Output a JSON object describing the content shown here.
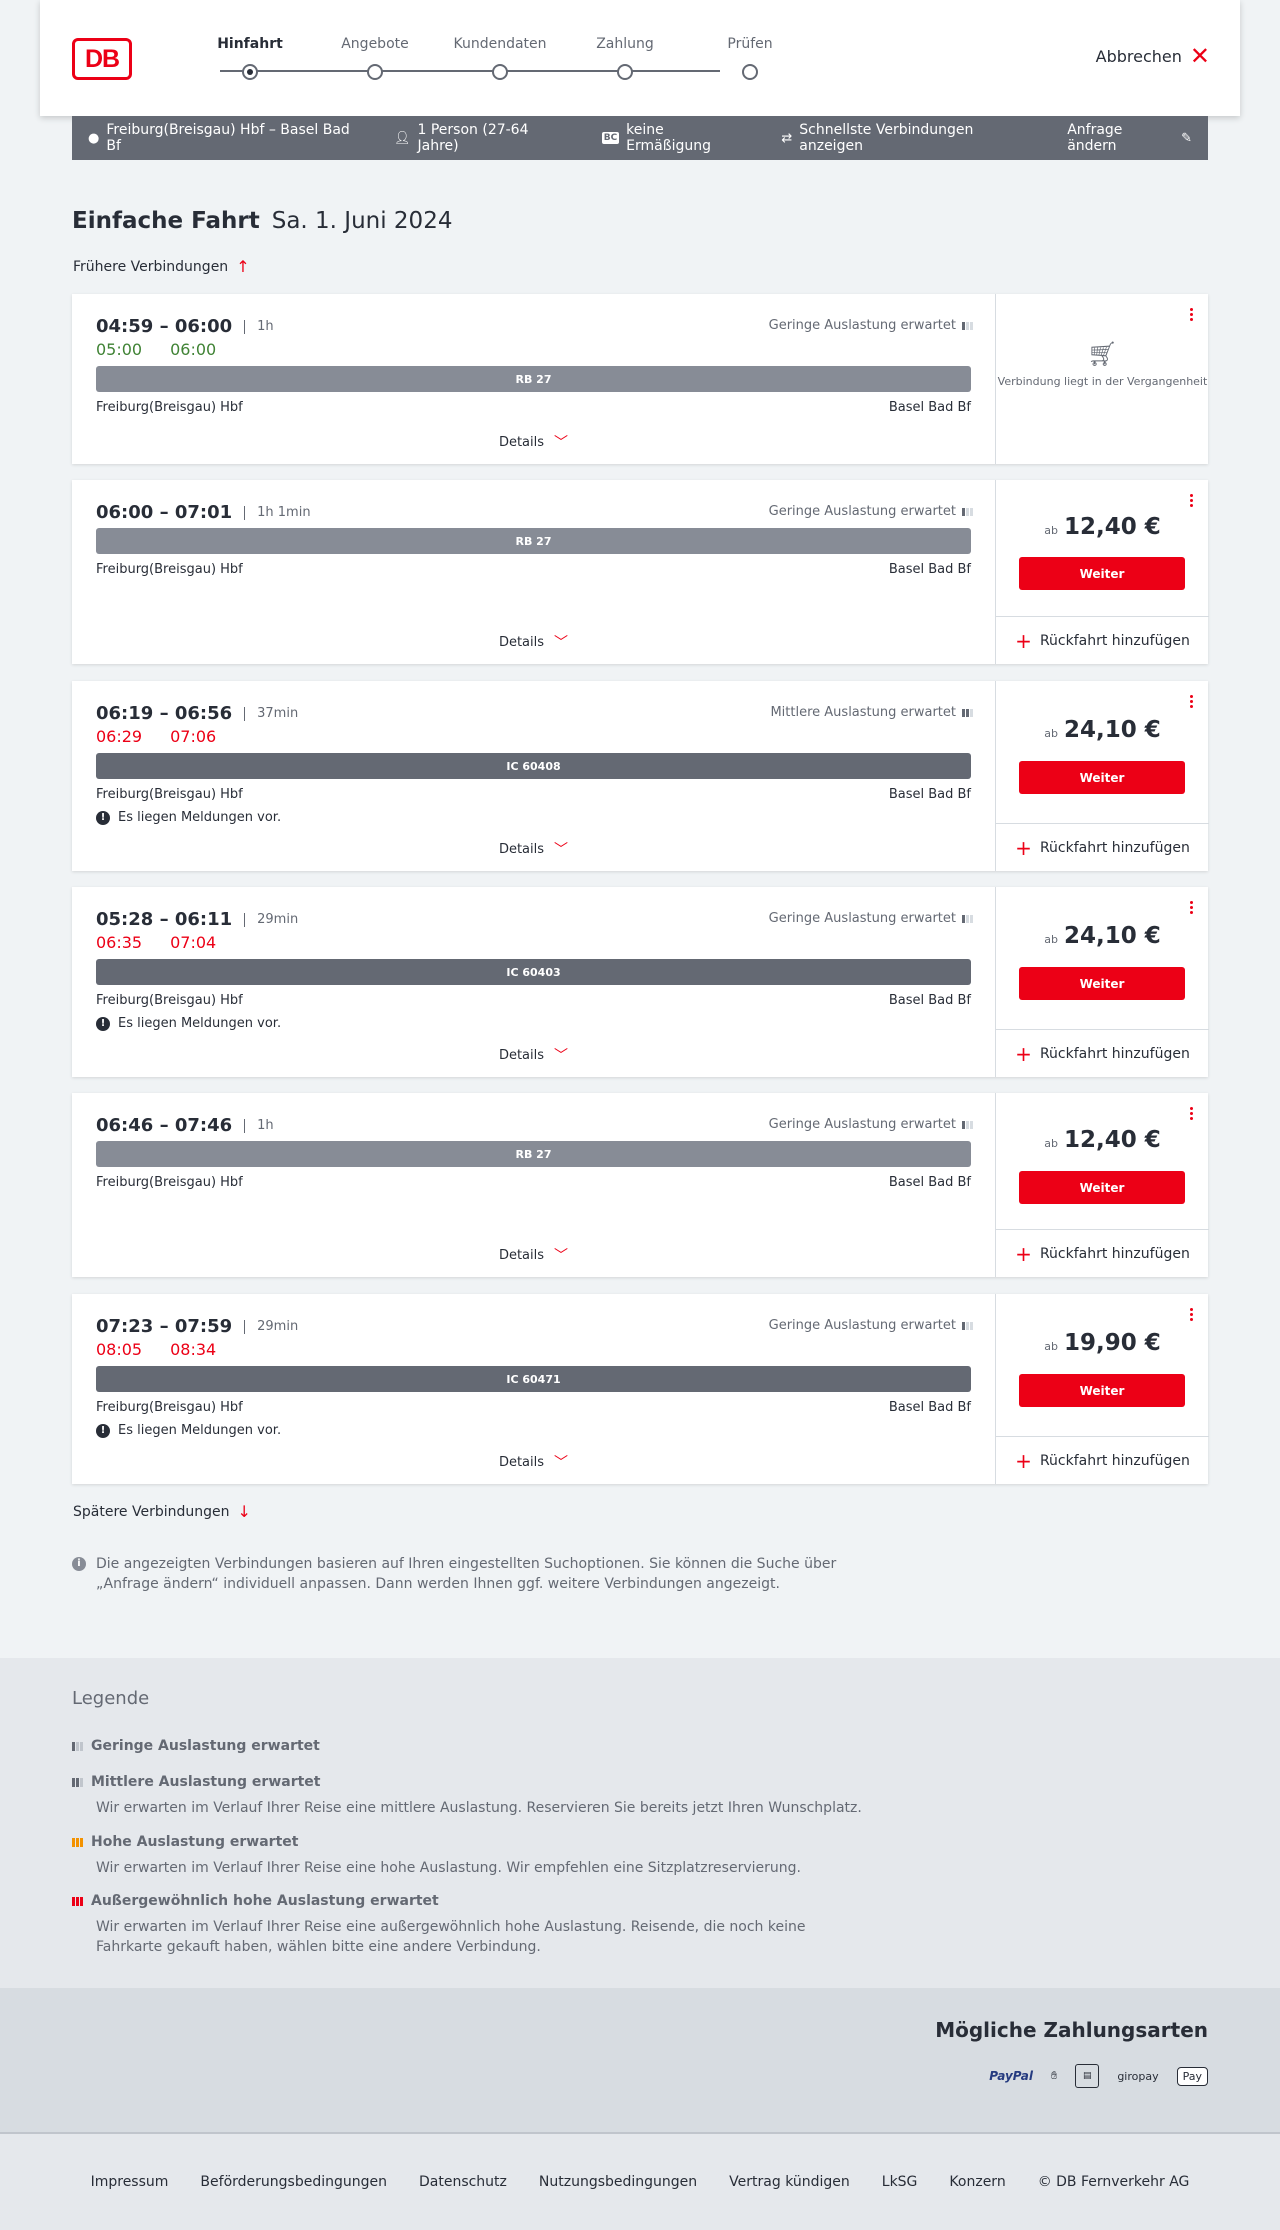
{
  "header": {
    "logo": "DB",
    "cancel_label": "Abbrechen",
    "steps": [
      {
        "label": "Hinfahrt"
      },
      {
        "label": "Angebote"
      },
      {
        "label": "Kundendaten"
      },
      {
        "label": "Zahlung"
      },
      {
        "label": "Prüfen"
      }
    ]
  },
  "summary": {
    "route": "Freiburg(Breisgau) Hbf – Basel Bad Bf",
    "passengers": "1 Person (27-64 Jahre)",
    "bc_badge": "BC",
    "discount": "keine Ermäßigung",
    "option": "Schnellste Verbindungen anzeigen",
    "change_label": "Anfrage ändern"
  },
  "title": {
    "main": "Einfache Fahrt",
    "date": "Sa. 1. Juni 2024"
  },
  "earlier_label": "Frühere Verbindungen",
  "later_label": "Spätere Verbindungen",
  "details_label": "Details",
  "weiter_label": "Weiter",
  "return_label": "Rückfahrt hinzufügen",
  "price_prefix": "ab",
  "connections": [
    {
      "times": "04:59 – 06:00",
      "duration": "1h",
      "rt_dep": "05:00",
      "rt_arr": "06:00",
      "load": "Geringe Auslastung erwartet",
      "train": "RB 27",
      "from": "Freiburg(Breisgau) Hbf",
      "to": "Basel Bad Bf",
      "past_text": "Verbindung liegt in der Vergangenheit"
    },
    {
      "times": "06:00 – 07:01",
      "duration": "1h 1min",
      "load": "Geringe Auslastung erwartet",
      "train": "RB 27",
      "from": "Freiburg(Breisgau) Hbf",
      "to": "Basel Bad Bf",
      "price": "12,40 €"
    },
    {
      "times": "06:19 – 06:56",
      "duration": "37min",
      "rt_dep": "06:29",
      "rt_arr": "07:06",
      "load": "Mittlere Auslastung erwartet",
      "train": "IC 60408",
      "from": "Freiburg(Breisgau) Hbf",
      "to": "Basel Bad Bf",
      "notice": "Es liegen Meldungen vor.",
      "price": "24,10 €"
    },
    {
      "times": "05:28 – 06:11",
      "duration": "29min",
      "rt_dep": "06:35",
      "rt_arr": "07:04",
      "load": "Geringe Auslastung erwartet",
      "train": "IC 60403",
      "from": "Freiburg(Breisgau) Hbf",
      "to": "Basel Bad Bf",
      "notice": "Es liegen Meldungen vor.",
      "price": "24,10 €"
    },
    {
      "times": "06:46 – 07:46",
      "duration": "1h",
      "load": "Geringe Auslastung erwartet",
      "train": "RB 27",
      "from": "Freiburg(Breisgau) Hbf",
      "to": "Basel Bad Bf",
      "price": "12,40 €"
    },
    {
      "times": "07:23 – 07:59",
      "duration": "29min",
      "rt_dep": "08:05",
      "rt_arr": "08:34",
      "load": "Geringe Auslastung erwartet",
      "train": "IC 60471",
      "from": "Freiburg(Breisgau) Hbf",
      "to": "Basel Bad Bf",
      "notice": "Es liegen Meldungen vor.",
      "price": "19,90 €"
    }
  ],
  "info_text": "Die angezeigten Verbindungen basieren auf Ihren eingestellten Suchoptionen. Sie können die Suche über „Anfrage ändern“ individuell anpassen. Dann werden Ihnen ggf. weitere Verbindungen angezeigt.",
  "legend": {
    "title": "Legende",
    "items": [
      {
        "title": "Geringe Auslastung erwartet",
        "desc": ""
      },
      {
        "title": "Mittlere Auslastung erwartet",
        "desc": "Wir erwarten im Verlauf Ihrer Reise eine mittlere Auslastung. Reservieren Sie bereits jetzt Ihren Wunschplatz."
      },
      {
        "title": "Hohe Auslastung erwartet",
        "desc": "Wir erwarten im Verlauf Ihrer Reise eine hohe Auslastung. Wir empfehlen eine Sitzplatzreservierung."
      },
      {
        "title": "Außergewöhnlich hohe Auslastung erwartet",
        "desc": "Wir erwarten im Verlauf Ihrer Reise eine außergewöhnlich hohe Auslastung. Reisende, die noch keine Fahrkarte gekauft haben, wählen bitte eine andere Verbindung."
      }
    ]
  },
  "payment": {
    "title": "Mögliche Zahlungsarten",
    "paypal": "PayPal",
    "giropay": "giropay",
    "applepay": "Pay"
  },
  "footer": {
    "links": [
      "Impressum",
      "Beförderungsbedingungen",
      "Datenschutz",
      "Nutzungsbedingungen",
      "Vertrag kündigen",
      "LkSG",
      "Konzern",
      "© DB Fernverkehr AG"
    ]
  },
  "colors": {
    "accent": "#ec0016",
    "realtime_ontime": "#408335",
    "text": "#282d37",
    "bar_dark": "#646973"
  }
}
